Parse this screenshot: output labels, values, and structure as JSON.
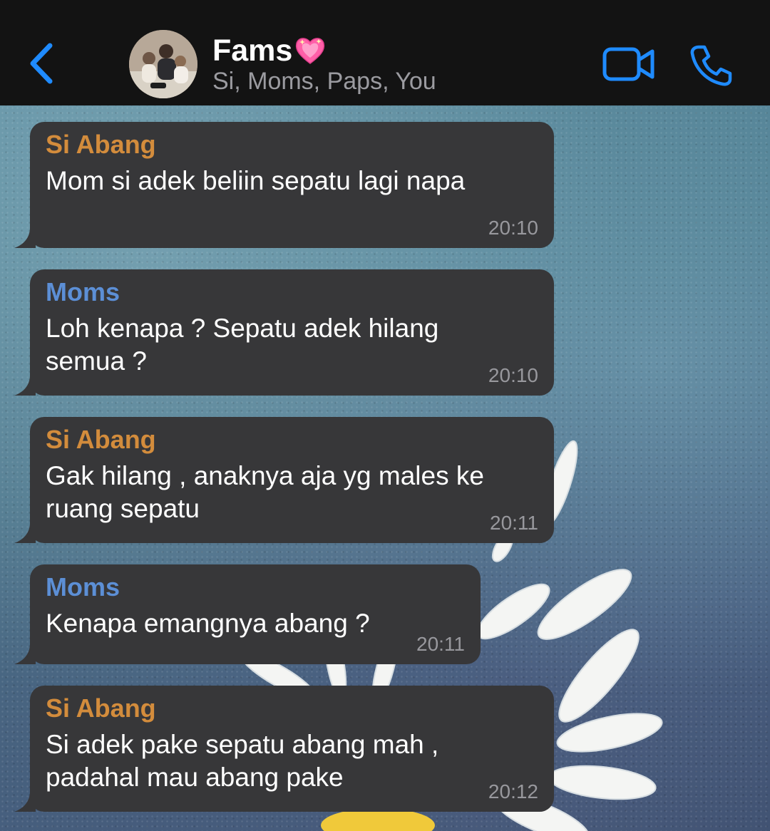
{
  "header": {
    "title": "Fams",
    "subtitle": "Si, Moms, Paps, You"
  },
  "colors": {
    "accent": "#1f8bff",
    "sender_si_abang": "#d38c3c",
    "sender_moms": "#5c8fd6",
    "bubble": "#373739",
    "header_bg": "#131313"
  },
  "icons": {
    "back": "chevron-left-icon",
    "title_emoji": "sparkling-heart-icon",
    "video": "video-camera-icon",
    "phone": "phone-icon"
  },
  "messages": [
    {
      "sender": "Si Abang",
      "lines": [
        "Mom si adek beliin sepatu lagi napa"
      ],
      "time": "20:10"
    },
    {
      "sender": "Moms",
      "lines": [
        "Loh kenapa ? Sepatu adek hilang",
        "semua ?"
      ],
      "time": "20:10"
    },
    {
      "sender": "Si Abang",
      "lines": [
        "Gak hilang , anaknya aja yg males ke",
        "ruang sepatu"
      ],
      "time": "20:11"
    },
    {
      "sender": "Moms",
      "lines": [
        "Kenapa emangnya abang ?"
      ],
      "time": "20:11"
    },
    {
      "sender": "Si Abang",
      "lines": [
        "Si adek pake sepatu abang mah ,",
        "padahal mau abang pake"
      ],
      "time": "20:12"
    }
  ]
}
